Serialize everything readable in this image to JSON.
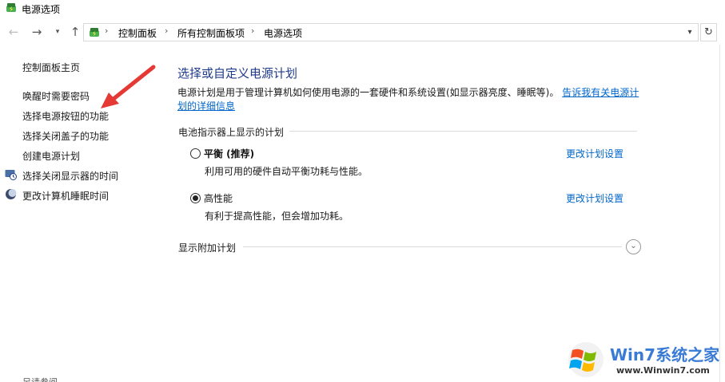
{
  "window": {
    "title": "电源选项",
    "icon": "power-options-icon"
  },
  "navigation": {
    "back_icon": "arrow-left-icon",
    "forward_icon": "arrow-right-icon",
    "recent_icon": "chevron-down-icon",
    "up_icon": "arrow-up-icon",
    "refresh_icon": "refresh-icon",
    "breadcrumbs": [
      "控制面板",
      "所有控制面板项",
      "电源选项"
    ]
  },
  "sidebar": {
    "home": "控制面板主页",
    "items": [
      {
        "label": "唤醒时需要密码",
        "icon": ""
      },
      {
        "label": "选择电源按钮的功能",
        "icon": ""
      },
      {
        "label": "选择关闭盖子的功能",
        "icon": ""
      },
      {
        "label": "创建电源计划",
        "icon": ""
      },
      {
        "label": "选择关闭显示器的时间",
        "icon": "display-clock-icon"
      },
      {
        "label": "更改计算机睡眠时间",
        "icon": "moon-icon"
      }
    ],
    "see_also": "另请参阅"
  },
  "main": {
    "title": "选择或自定义电源计划",
    "description": "电源计划是用于管理计算机如何使用电源的一套硬件和系统设置(如显示器亮度、睡眠等)。",
    "description_link": "告诉我有关电源计划的详细信息",
    "section_label": "电池指示器上显示的计划",
    "plans": [
      {
        "name": "平衡 (推荐)",
        "description": "利用可用的硬件自动平衡功耗与性能。",
        "link": "更改计划设置",
        "selected": false
      },
      {
        "name": "高性能",
        "description": "有利于提高性能，但会增加功耗。",
        "link": "更改计划设置",
        "selected": true
      }
    ],
    "show_additional": "显示附加计划"
  },
  "watermark": {
    "name": "Win7系统之家",
    "url": "www.Winwin7.com"
  },
  "colors": {
    "link": "#0066cc",
    "title": "#1e3a8a",
    "annotation_arrow": "#e53935"
  }
}
